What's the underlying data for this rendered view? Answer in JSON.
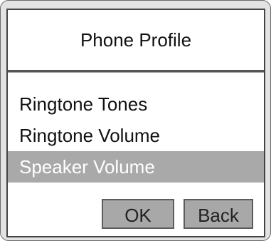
{
  "header": {
    "title": "Phone Profile"
  },
  "menu": {
    "items": [
      {
        "label": "Ringtone Tones"
      },
      {
        "label": "Ringtone Volume"
      },
      {
        "label": "Speaker Volume",
        "selected": true
      }
    ]
  },
  "softkeys": {
    "ok_label": "OK",
    "back_label": "Back"
  },
  "colors": {
    "selection": "#a9a9a9",
    "softkey_bg": "#a8a8a8",
    "frame": "#444444"
  }
}
